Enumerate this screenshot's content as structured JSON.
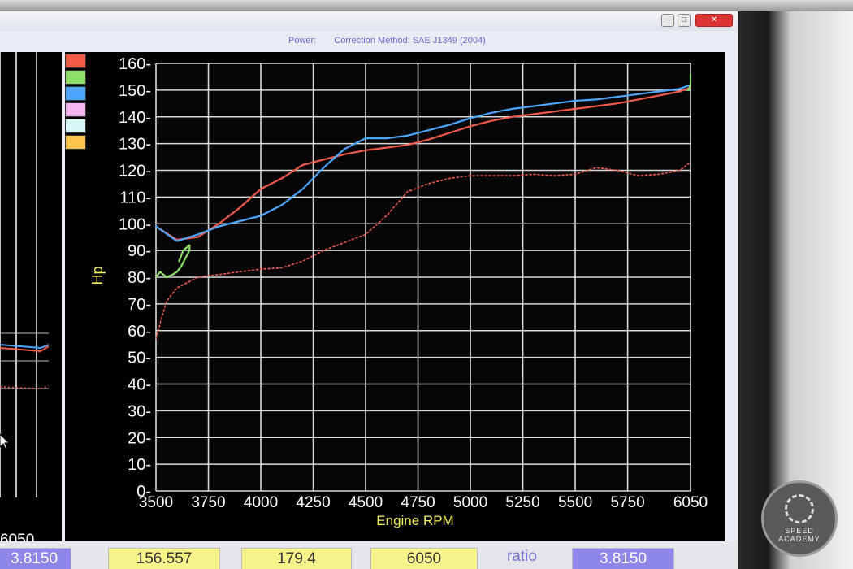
{
  "window": {
    "subtitle_power": "Power:",
    "subtitle_method": "Correction Method: SAE J1349 (2004)"
  },
  "left_panel": {
    "tick_label": "6050"
  },
  "legend_colors": [
    "#f25a4a",
    "#8fe06a",
    "#4da6ff",
    "#f6b6f0",
    "#d8f8f8",
    "#ffc34a"
  ],
  "chart_data": {
    "type": "line",
    "xlabel": "Engine RPM",
    "ylabel": "Hp",
    "xlim": [
      3500,
      6050
    ],
    "ylim": [
      0,
      160
    ],
    "xticks": [
      "3500",
      "3750",
      "4000",
      "4250",
      "4500",
      "4750",
      "5000",
      "5250",
      "5500",
      "5750",
      "6050"
    ],
    "yticks": [
      "0",
      "10",
      "20",
      "30",
      "40",
      "50",
      "60",
      "70",
      "80",
      "90",
      "100",
      "110",
      "120",
      "130",
      "140",
      "150",
      "160"
    ],
    "grid": true,
    "series": [
      {
        "color": "#f25a4a",
        "style": "solid",
        "x": [
          3500,
          3600,
          3700,
          3800,
          3900,
          4000,
          4100,
          4200,
          4300,
          4400,
          4500,
          4600,
          4700,
          4800,
          4900,
          5000,
          5100,
          5200,
          5300,
          5400,
          5500,
          5600,
          5700,
          5800,
          5900,
          6000,
          6050
        ],
        "y": [
          99,
          94,
          95,
          100,
          106,
          113,
          117,
          122,
          124,
          126,
          127.5,
          128.5,
          129.5,
          131.5,
          134,
          136.5,
          138.5,
          140,
          141,
          142,
          143,
          144,
          145,
          146.5,
          148,
          149.5,
          151
        ]
      },
      {
        "color": "#4da6ff",
        "style": "solid",
        "x": [
          3500,
          3600,
          3700,
          3800,
          3900,
          4000,
          4100,
          4200,
          4300,
          4400,
          4500,
          4600,
          4700,
          4800,
          4900,
          5000,
          5100,
          5200,
          5300,
          5400,
          5500,
          5600,
          5700,
          5800,
          5900,
          6000,
          6050
        ],
        "y": [
          99,
          93.5,
          96,
          99,
          101,
          103,
          107,
          113,
          121,
          128,
          132,
          132,
          133,
          135,
          137,
          139.5,
          141.5,
          143,
          144,
          145,
          146,
          146.5,
          147.5,
          148.5,
          149.5,
          150.5,
          152
        ]
      },
      {
        "color": "#f25a4a",
        "style": "dashed",
        "x": [
          3500,
          3550,
          3600,
          3650,
          3700,
          3800,
          3900,
          4000,
          4100,
          4200,
          4300,
          4400,
          4500,
          4600,
          4700,
          4800,
          4900,
          5000,
          5100,
          5200,
          5300,
          5400,
          5500,
          5600,
          5700,
          5800,
          5900,
          6000,
          6050
        ],
        "y": [
          57,
          71,
          76,
          78,
          80,
          81,
          82,
          83,
          83.5,
          86,
          90,
          93,
          96,
          103,
          112,
          115,
          117,
          118,
          118,
          118,
          118.5,
          118,
          118.5,
          121,
          120,
          118,
          118.5,
          120,
          123
        ]
      },
      {
        "color": "#8fe06a",
        "style": "solid",
        "x": [
          3500,
          3520,
          3550,
          3580,
          3600,
          3620,
          3640,
          3660,
          3660,
          3630,
          3610
        ],
        "y": [
          80,
          82,
          80,
          81,
          82,
          84,
          87,
          90,
          92,
          90,
          86
        ]
      },
      {
        "color": "#8fe06a",
        "style": "solid",
        "x": [
          6040,
          6050,
          6050
        ],
        "y": [
          150,
          152,
          156
        ]
      }
    ]
  },
  "bottom_bar": {
    "field1": "156.557",
    "field2": "179.4",
    "field3": "6050",
    "ratio_label": "ratio",
    "ratio_value": "3.8150",
    "left_value": "3.8150"
  },
  "badge": {
    "text": "SPEED ACADEMY"
  }
}
